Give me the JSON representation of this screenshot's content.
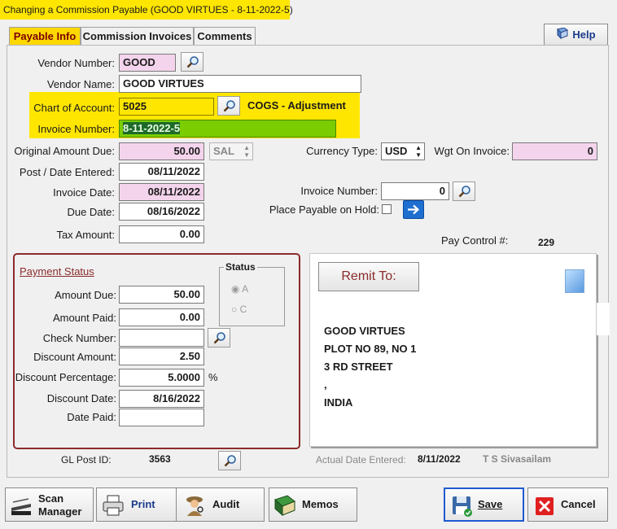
{
  "window": {
    "title": "Changing a Commission Payable  (GOOD VIRTUES - 8-11-2022-5)"
  },
  "tabs": [
    {
      "label": "Payable Info"
    },
    {
      "label": "Commission Invoices"
    },
    {
      "label": "Comments"
    }
  ],
  "help_label": "Help",
  "vendor": {
    "number_label": "Vendor Number:",
    "number_value": "GOOD",
    "name_label": "Vendor Name:",
    "name_value": "GOOD VIRTUES"
  },
  "account": {
    "label": "Chart of Account:",
    "value": "5025",
    "description": "COGS - Adjustment"
  },
  "invoice": {
    "label": "Invoice Number:",
    "value": "8-11-2022-5"
  },
  "amounts": {
    "original_due_label": "Original Amount Due:",
    "original_due": "50.00",
    "unit": "SAL",
    "currency_label": "Currency Type:",
    "currency": "USD",
    "wgt_label": "Wgt On Invoice:",
    "wgt": "0"
  },
  "dates": {
    "post_label": "Post / Date Entered:",
    "post": "08/11/2022",
    "invoice_label": "Invoice Date:",
    "invoice": "08/11/2022",
    "due_label": "Due Date:",
    "due": "08/16/2022",
    "tax_label": "Tax Amount:",
    "tax": "0.00"
  },
  "invoice_number2": {
    "label": "Invoice  Number:",
    "value": "0"
  },
  "hold": {
    "label": "Place Payable on Hold:",
    "checked": false
  },
  "pay_control": {
    "label": "Pay Control #:",
    "value": "229"
  },
  "payment_status": {
    "title": "Payment Status",
    "amount_due_label": "Amount Due:",
    "amount_due": "50.00",
    "amount_paid_label": "Amount Paid:",
    "amount_paid": "0.00",
    "check_number_label": "Check Number:",
    "check_number": "",
    "discount_amount_label": "Discount Amount:",
    "discount_amount": "2.50",
    "discount_pct_label": "Discount Percentage:",
    "discount_pct": "5.0000",
    "pct_sign": "%",
    "discount_date_label": "Discount Date:",
    "discount_date": "8/16/2022",
    "date_paid_label": "Date Paid:",
    "date_paid": "",
    "status": {
      "title": "Status",
      "options": [
        "A",
        "C"
      ],
      "selected": "A"
    }
  },
  "remit": {
    "button_label": "Remit To:",
    "lines": [
      "GOOD VIRTUES",
      "PLOT NO 89, NO 1",
      "3 RD STREET",
      ",",
      "INDIA"
    ]
  },
  "gl": {
    "label": "GL Post  ID:",
    "value": "3563"
  },
  "actual": {
    "label": "Actual Date Entered:",
    "date": "8/11/2022",
    "user": "T S Sivasailam"
  },
  "buttons": {
    "scan_line1": "Scan",
    "scan_line2": "Manager",
    "print": "Print",
    "audit": "Audit",
    "memos": "Memos",
    "save": "Save",
    "cancel": "Cancel"
  },
  "colors": {
    "highlight": "#ffe600",
    "pink": "#f4d4ec",
    "invoice_green": "#7bcc00",
    "status_border": "#8b2b2b",
    "cancel_red": "#e02020"
  }
}
